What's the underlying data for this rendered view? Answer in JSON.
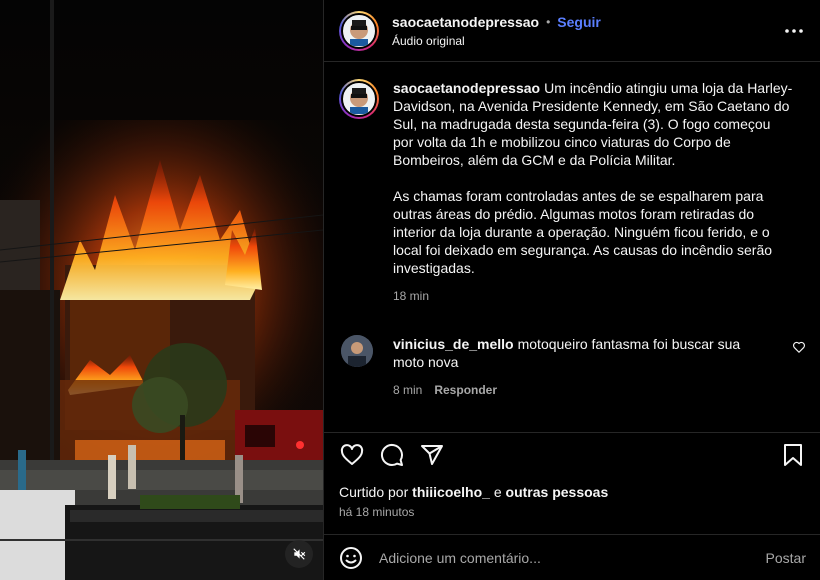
{
  "post": {
    "username": "saocaetanodepressao",
    "separator": "•",
    "follow_label": "Seguir",
    "audio_label": "Áudio original"
  },
  "caption": {
    "username": "saocaetanodepressao",
    "paragraph1": "Um incêndio atingiu uma loja da Harley-Davidson, na Avenida Presidente Kennedy, em São Caetano do Sul, na madrugada desta segunda-feira (3). O fogo começou por volta da 1h e mobilizou cinco viaturas do Corpo de Bombeiros, além da GCM e da Polícia Militar.",
    "paragraph2": "As chamas foram controladas antes de se espalharem para outras áreas do prédio. Algumas motos foram retiradas do interior da loja durante a operação. Ninguém ficou ferido, e o local foi deixado em segurança. As causas do incêndio serão investigadas.",
    "time": "18 min"
  },
  "comments": [
    {
      "username": "vinicius_de_mello",
      "text": "motoqueiro fantasma foi buscar sua moto nova",
      "time": "8 min",
      "reply_label": "Responder"
    }
  ],
  "likes": {
    "prefix": "Curtido por",
    "user": "thiiicoelho_",
    "joiner": "e",
    "others": "outras pessoas",
    "time_ago": "há 18 minutos"
  },
  "add_comment": {
    "placeholder": "Adicione um comentário...",
    "post_label": "Postar"
  },
  "icons": {
    "more": "more-horizontal-icon",
    "like": "heart-icon",
    "comment": "comment-bubble-icon",
    "share": "paper-plane-icon",
    "save": "bookmark-icon",
    "mute": "speaker-muted-icon",
    "emoji": "smiley-icon"
  },
  "colors": {
    "background": "#000000",
    "follow_blue": "#5b7fff",
    "secondary_text": "#a8a8a8",
    "border": "#262626",
    "fire": "#ff6a00"
  }
}
